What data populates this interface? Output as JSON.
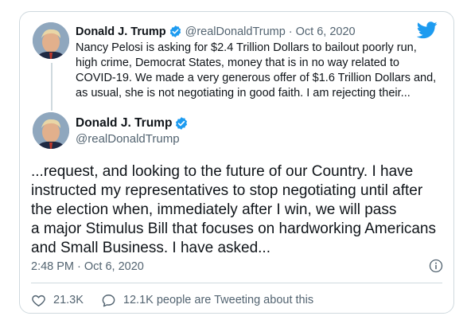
{
  "quoted": {
    "name": "Donald J. Trump",
    "handle": "@realDonaldTrump",
    "date": "Oct 6, 2020",
    "text_lines": [
      "Nancy Pelosi is asking for $2.4 Trillion Dollars to bailout poorly run,",
      "high crime, Democrat States, money that is in no way related to",
      "COVID-19. We made a very generous offer of $1.6 Trillion Dollars and,",
      "as usual, she is not negotiating in good faith. I am rejecting their..."
    ]
  },
  "main": {
    "name": "Donald J. Trump",
    "handle": "@realDonaldTrump",
    "text_lines": [
      "...request, and looking to the future of our Country. I have",
      "instructed my representatives to stop negotiating until after",
      "the election when, immediately after I win, we will pass",
      "a major Stimulus Bill that focuses on hardworking Americans",
      "and Small Business. I have asked..."
    ],
    "timestamp": "2:48 PM · Oct 6, 2020"
  },
  "actions": {
    "likes": "21.3K",
    "tweeting": "12.1K people are Tweeting about this"
  },
  "colors": {
    "twitter_blue": "#1d9bf0",
    "verified": "#1d9bf0",
    "secondary_text": "#536471",
    "border": "#cfd9de"
  },
  "icons": {
    "logo": "twitter-bird-icon",
    "verified": "verified-badge-icon",
    "info": "info-icon",
    "like": "heart-icon",
    "reply": "speech-bubble-icon"
  }
}
